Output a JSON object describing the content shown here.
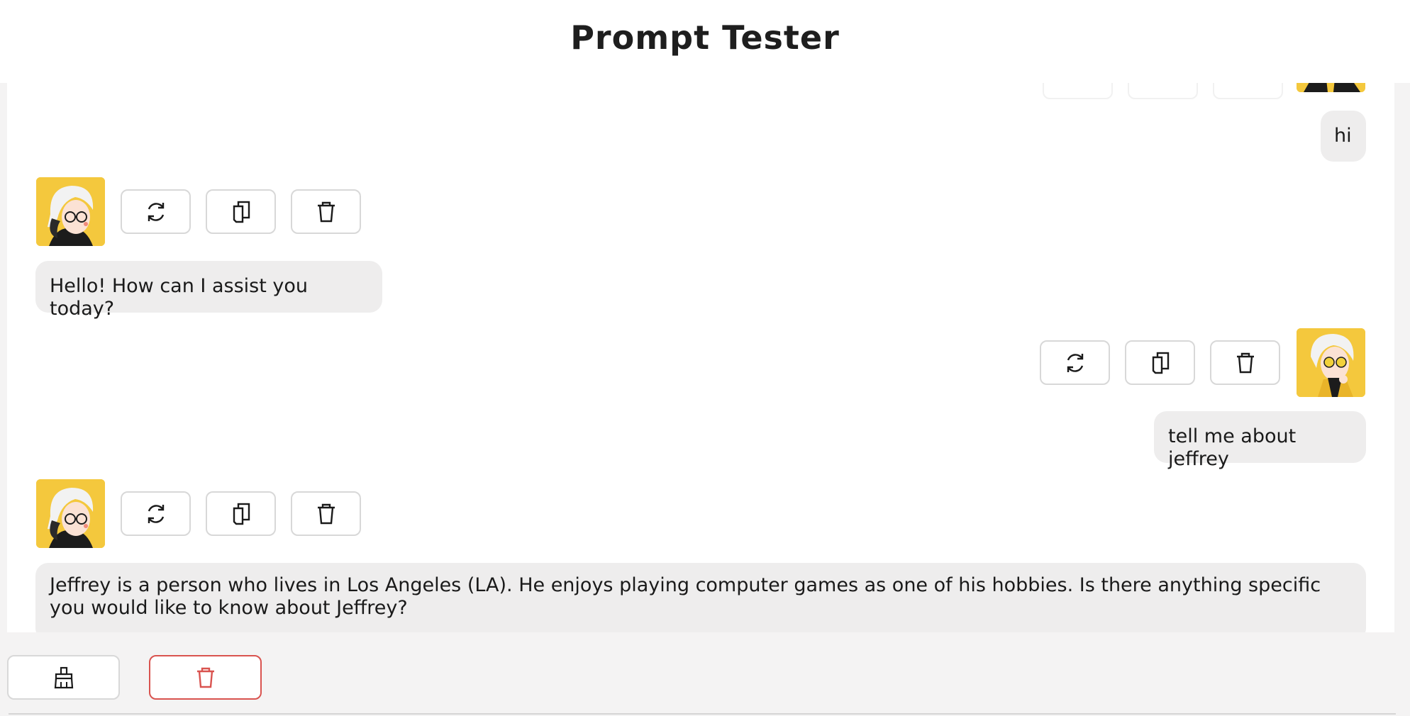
{
  "app": {
    "title": "Prompt Tester"
  },
  "messages": [
    {
      "role": "user",
      "text": "hi"
    },
    {
      "role": "assistant",
      "text": "Hello! How can I assist you today?"
    },
    {
      "role": "user",
      "text": "tell me about jeffrey"
    },
    {
      "role": "assistant",
      "text": "Jeffrey is a person who lives in Los Angeles (LA). He enjoys playing computer games as one of his hobbies. Is there anything specific you would like to know about Jeffrey?"
    }
  ],
  "message_actions": [
    "regenerate-icon",
    "copy-icon",
    "trash-icon"
  ],
  "footer": {
    "clear_icon": "broom-icon",
    "delete_icon": "trash-icon"
  },
  "colors": {
    "avatar_bg": "#f4c83d",
    "bubble_bg": "#eeeded",
    "delete_border": "#d9534f"
  }
}
